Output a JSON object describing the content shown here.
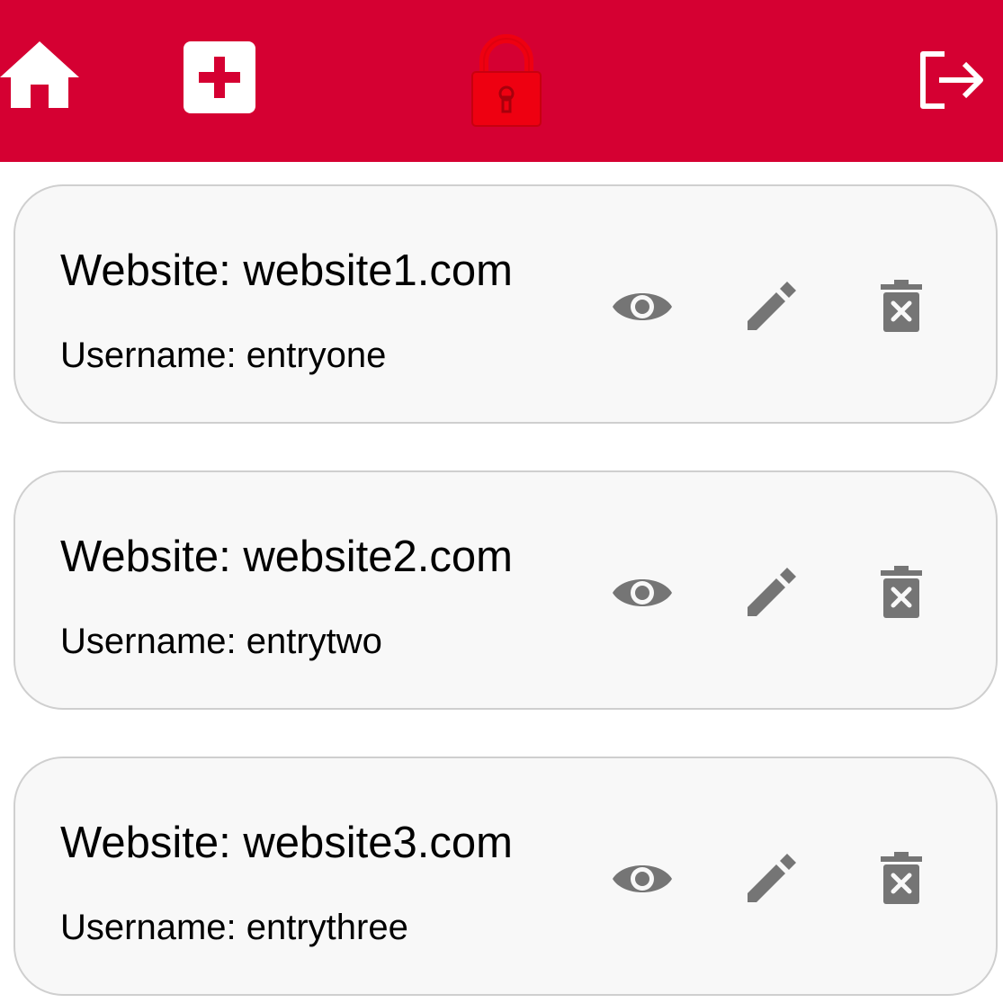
{
  "header": {
    "background_color": "#d50032",
    "home_icon": "home-icon",
    "add_icon": "add-entry-icon",
    "lock_icon": "lock-icon",
    "lock_color": "#ee0011",
    "logout_icon": "logout-icon"
  },
  "entries": [
    {
      "website_label": "Website: website1.com",
      "username_label": "Username: entryone"
    },
    {
      "website_label": "Website: website2.com",
      "username_label": "Username: entrytwo"
    },
    {
      "website_label": "Website: website3.com",
      "username_label": "Username: entrythree"
    }
  ],
  "entry_actions": {
    "view_icon": "eye-icon",
    "edit_icon": "pencil-icon",
    "delete_icon": "trash-icon",
    "icon_color": "#757575"
  }
}
